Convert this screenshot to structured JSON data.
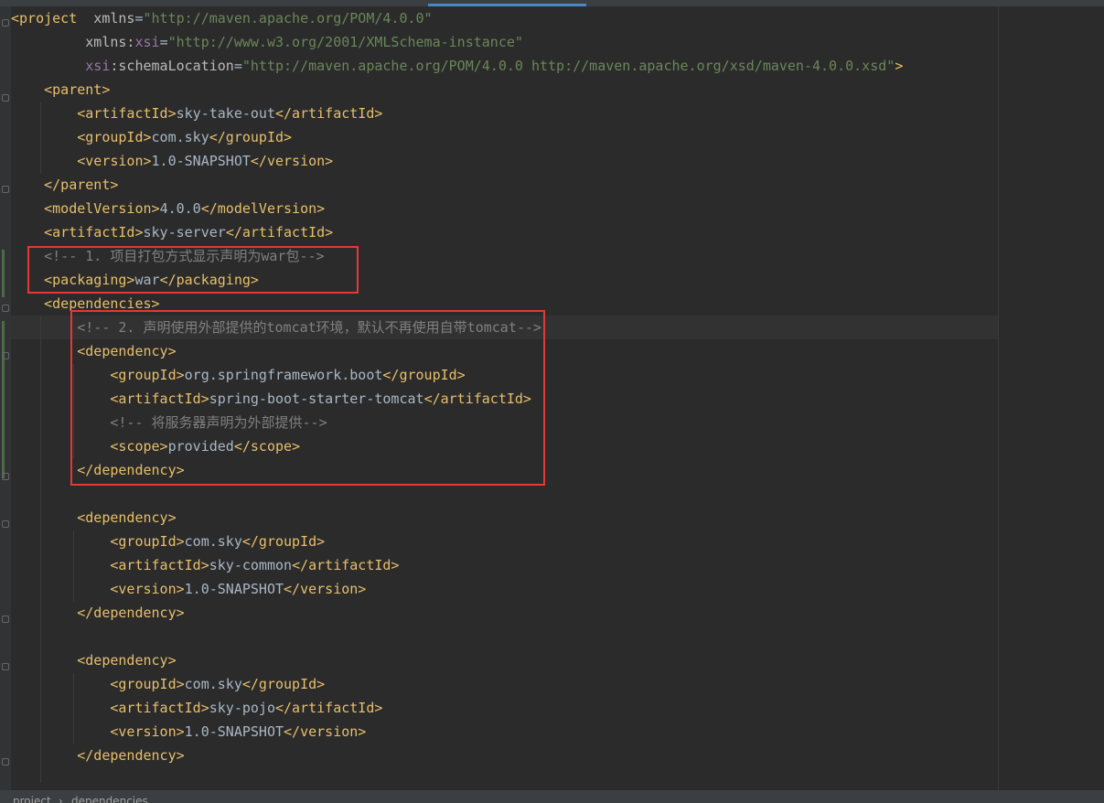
{
  "colors": {
    "background": "#2b2b2b",
    "tag": "#e8bf6a",
    "attribute": "#bababa",
    "namespace": "#9876aa",
    "attribute_value": "#6a8759",
    "text": "#a9b7c6",
    "comment": "#808080",
    "highlight_box": "#e53935"
  },
  "editor": {
    "lines": [
      [
        "<project ",
        " xmlns",
        "=",
        "\"http://maven.apache.org/POM/4.0.0\""
      ],
      [
        "         ",
        "xmlns:",
        "xsi",
        "=",
        "\"http://www.w3.org/2001/XMLSchema-instance\""
      ],
      [
        "         ",
        "xsi",
        ":schemaLocation",
        "=",
        "\"http://maven.apache.org/POM/4.0.0 http://maven.apache.org/xsd/maven-4.0.0.xsd\"",
        ">"
      ],
      [
        "    ",
        "<parent>"
      ],
      [
        "        ",
        "<artifactId>",
        "sky-take-out",
        "</artifactId>"
      ],
      [
        "        ",
        "<groupId>",
        "com.sky",
        "</groupId>"
      ],
      [
        "        ",
        "<version>",
        "1.0-SNAPSHOT",
        "</version>"
      ],
      [
        "    ",
        "</parent>"
      ],
      [
        "    ",
        "<modelVersion>",
        "4.0.0",
        "</modelVersion>"
      ],
      [
        "    ",
        "<artifactId>",
        "sky-server",
        "</artifactId>"
      ],
      [
        "    ",
        "<!-- 1. 项目打包方式显示声明为war包-->"
      ],
      [
        "    ",
        "<packaging>",
        "war",
        "</packaging>"
      ],
      [
        "    ",
        "<dependencies>"
      ],
      [
        "        ",
        "<!-- 2. 声明使用外部提供的tomcat环境，默认不再使用自带tomcat-->"
      ],
      [
        "        ",
        "<dependency>"
      ],
      [
        "            ",
        "<groupId>",
        "org.springframework.boot",
        "</groupId>"
      ],
      [
        "            ",
        "<artifactId>",
        "spring-boot-starter-tomcat",
        "</artifactId>"
      ],
      [
        "            ",
        "<!-- 将服务器声明为外部提供-->"
      ],
      [
        "            ",
        "<scope>",
        "provided",
        "</scope>"
      ],
      [
        "        ",
        "</dependency>"
      ],
      [
        ""
      ],
      [
        "        ",
        "<dependency>"
      ],
      [
        "            ",
        "<groupId>",
        "com.sky",
        "</groupId>"
      ],
      [
        "            ",
        "<artifactId>",
        "sky-common",
        "</artifactId>"
      ],
      [
        "            ",
        "<version>",
        "1.0-SNAPSHOT",
        "</version>"
      ],
      [
        "        ",
        "</dependency>"
      ],
      [
        ""
      ],
      [
        "        ",
        "<dependency>"
      ],
      [
        "            ",
        "<groupId>",
        "com.sky",
        "</groupId>"
      ],
      [
        "            ",
        "<artifactId>",
        "sky-pojo",
        "</artifactId>"
      ],
      [
        "            ",
        "<version>",
        "1.0-SNAPSHOT",
        "</version>"
      ],
      [
        "        ",
        "</dependency>"
      ],
      [
        ""
      ]
    ]
  },
  "breadcrumb": {
    "project": "project",
    "separator": "›",
    "dependencies": "dependencies"
  }
}
